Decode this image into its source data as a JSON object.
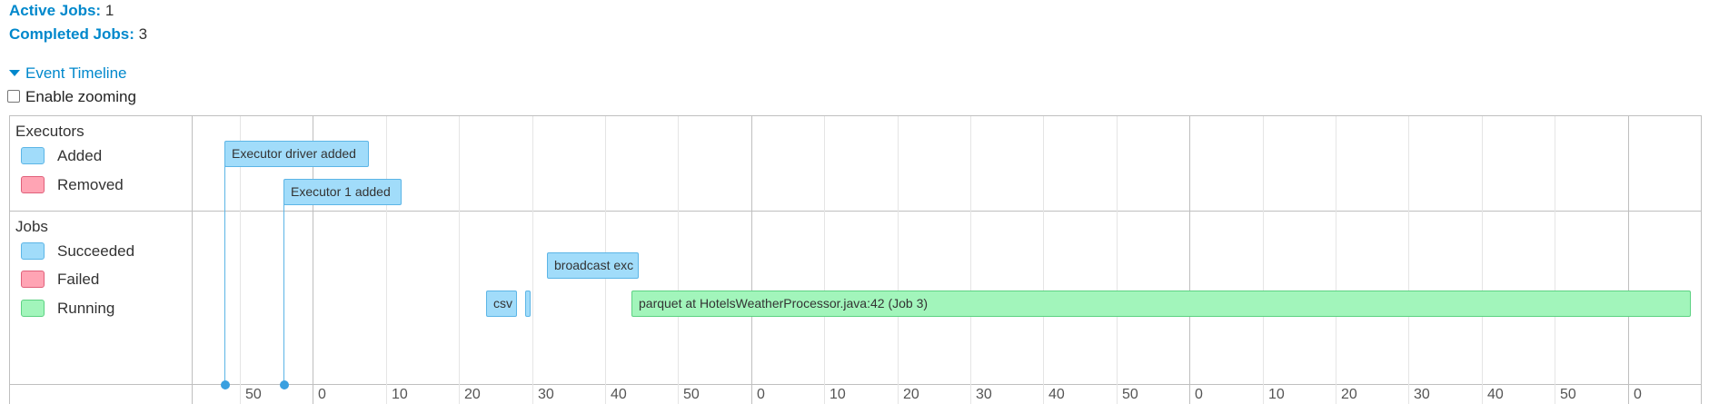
{
  "summary": {
    "active_label": "Active Jobs:",
    "active_value": "1",
    "completed_label": "Completed Jobs:",
    "completed_value": "3"
  },
  "timeline": {
    "toggle_label": "Event Timeline",
    "zoom_label": "Enable zooming",
    "zoom_checked": false,
    "executors": {
      "title": "Executors",
      "legend": [
        {
          "label": "Added",
          "color": "#a1dcfa",
          "border": "#5cb5e6"
        },
        {
          "label": "Removed",
          "color": "#ffa4b4",
          "border": "#e0607a"
        }
      ],
      "events": [
        {
          "label": "Executor driver added"
        },
        {
          "label": "Executor 1 added"
        }
      ]
    },
    "jobs": {
      "title": "Jobs",
      "legend": [
        {
          "label": "Succeeded",
          "color": "#a1dcfa",
          "border": "#5cb5e6"
        },
        {
          "label": "Failed",
          "color": "#ffa4b4",
          "border": "#e0607a"
        },
        {
          "label": "Running",
          "color": "#a2f5bb",
          "border": "#5cd282"
        }
      ],
      "bars": [
        {
          "label": "broadcast exc",
          "status": "succeeded"
        },
        {
          "label": "csv",
          "status": "succeeded"
        },
        {
          "label": "",
          "status": "succeeded"
        },
        {
          "label": "parquet at HotelsWeatherProcessor.java:42 (Job 3)",
          "status": "running"
        }
      ]
    },
    "axis_ticks": [
      "50",
      "0",
      "10",
      "20",
      "30",
      "40",
      "50",
      "0",
      "10",
      "20",
      "30",
      "40",
      "50",
      "0",
      "10",
      "20",
      "30",
      "40",
      "50",
      "0"
    ]
  }
}
